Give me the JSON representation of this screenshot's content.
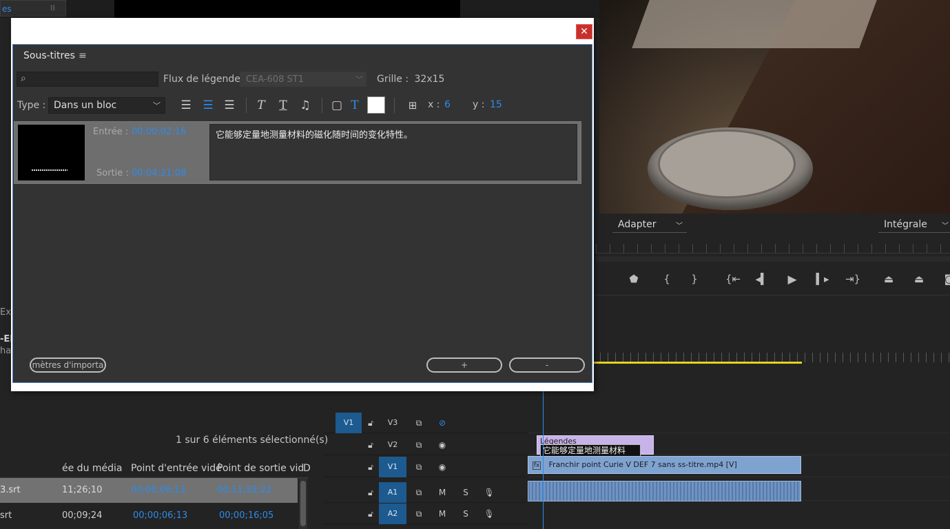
{
  "background": {
    "top_tab_label": "es",
    "program_monitor": {
      "zoom_select": "Adapter",
      "quality_select": "Intégrale"
    },
    "left_fragments": [
      "Exp",
      "-EN",
      "ha"
    ]
  },
  "project_panel": {
    "selection_count": "1 sur 6 éléments sélectionné(s)",
    "columns": [
      "ée du média",
      "Point d'entrée vidé",
      "Point de sortie vid",
      "D"
    ],
    "rows": [
      {
        "name": "3.srt",
        "media_start": "11;26;10",
        "video_in": "00;00;06;13",
        "video_out": "00;11;32;22"
      },
      {
        "name": "srt",
        "media_start": "00;09;24",
        "video_in": "00;00;06;13",
        "video_out": "00;00;16;05"
      }
    ]
  },
  "timeline": {
    "tracks": [
      {
        "source": "V1",
        "name": "V3",
        "type": "video"
      },
      {
        "source": "",
        "name": "V2",
        "type": "video"
      },
      {
        "source": "",
        "name": "V1",
        "type": "video"
      },
      {
        "source": "",
        "name": "A1",
        "type": "audio",
        "mute": "M",
        "solo": "S"
      },
      {
        "source": "",
        "name": "A2",
        "type": "audio",
        "mute": "M",
        "solo": "S"
      }
    ],
    "caption_clip_label": "Légendes",
    "caption_clip_preview": "它能够定量地测量材料",
    "video_clip_label": "Franchir point Curie V DEF 7 sans ss-titre.mp4 [V]"
  },
  "dialog": {
    "panel_title": "Sous-titres",
    "search_placeholder": "",
    "stream_label": "Flux de légende :",
    "stream_value": "CEA-608 ST1",
    "grid_label": "Grille :",
    "grid_value": "32x15",
    "type_label": "Type :",
    "type_value": "Dans un bloc",
    "x_label": "x :",
    "x_value": "6",
    "y_label": "y :",
    "y_value": "15",
    "caption": {
      "in_label": "Entrée :",
      "in_value": "00:00:02:16",
      "out_label": "Sortie :",
      "out_value": "00:04:21:08",
      "text": "它能够定量地测量材料的磁化随时间的变化特性。"
    },
    "import_button": "mètres d'importa",
    "add_button": "+",
    "remove_button": "-"
  },
  "colors": {
    "accent_blue": "#2d8ceb",
    "track_patch_blue": "#1c5a8f",
    "close_red": "#c9302c",
    "work_area_yellow": "#e6d21e"
  }
}
